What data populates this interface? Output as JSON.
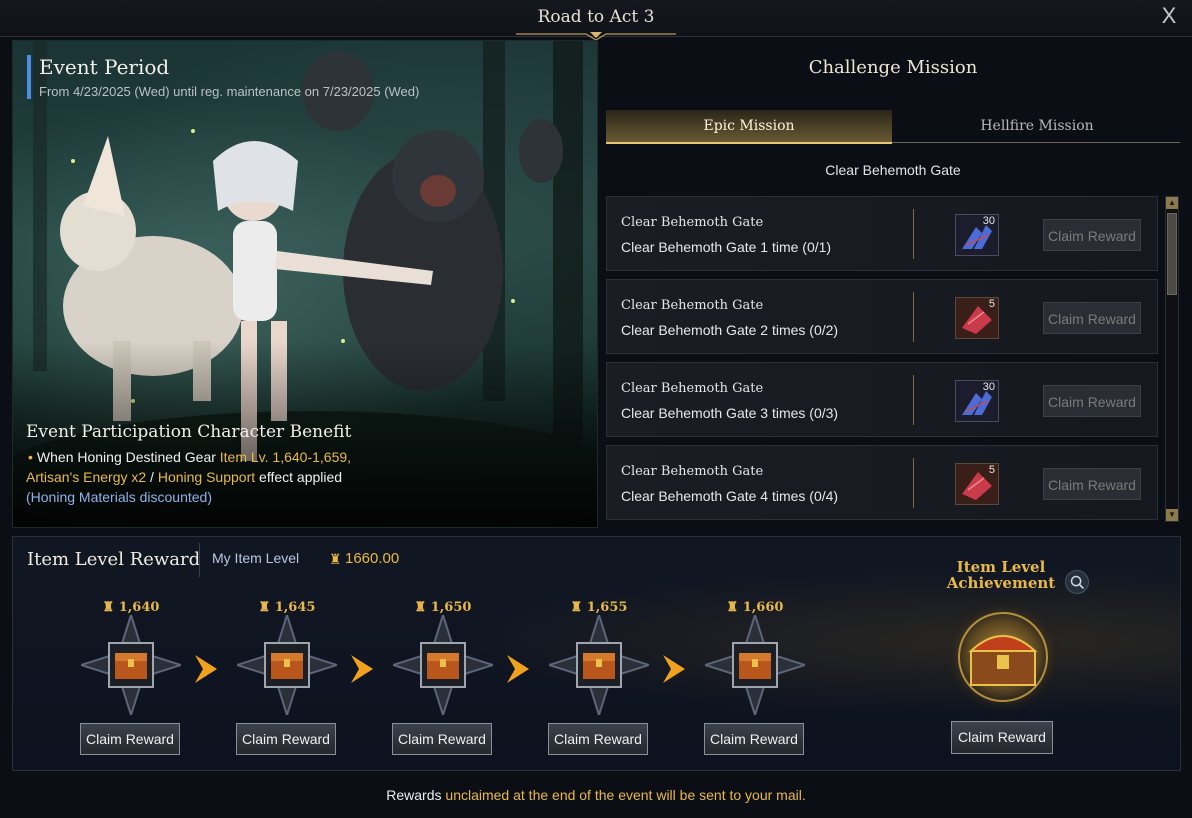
{
  "window": {
    "title": "Road to Act 3",
    "close_label": "X"
  },
  "banner": {
    "event_period_title": "Event Period",
    "event_period_dates": "From 4/23/2025 (Wed) until reg. maintenance on 7/23/2025 (Wed)",
    "benefit_title": "Event Participation Character Benefit",
    "benefit_line_prefix": "When Honing Destined Gear ",
    "benefit_item_level": "Item Lv. 1,640-1,659,",
    "benefit_energy": "Artisan's Energy x2",
    "benefit_slash": " / ",
    "benefit_support": "Honing Support",
    "benefit_suffix": " effect applied",
    "benefit_note": "(Honing Materials discounted)"
  },
  "challenge": {
    "title": "Challenge Mission",
    "tabs": [
      {
        "label": "Epic Mission",
        "active": true
      },
      {
        "label": "Hellfire Mission",
        "active": false
      }
    ],
    "heading": "Clear Behemoth Gate",
    "missions": [
      {
        "title": "Clear Behemoth Gate",
        "desc": "Clear Behemoth Gate 1 time (0/1)",
        "reward_count": "30",
        "reward_icon": "blue-crystal-icon",
        "claim_label": "Claim Reward"
      },
      {
        "title": "Clear Behemoth Gate",
        "desc": "Clear Behemoth Gate 2 times (0/2)",
        "reward_count": "5",
        "reward_icon": "red-crystal-icon",
        "claim_label": "Claim Reward"
      },
      {
        "title": "Clear Behemoth Gate",
        "desc": "Clear Behemoth Gate 3 times (0/3)",
        "reward_count": "30",
        "reward_icon": "blue-crystal-icon",
        "claim_label": "Claim Reward"
      },
      {
        "title": "Clear Behemoth Gate",
        "desc": "Clear Behemoth Gate 4 times (0/4)",
        "reward_count": "5",
        "reward_icon": "red-crystal-icon",
        "claim_label": "Claim Reward"
      }
    ]
  },
  "item_level_reward": {
    "title": "Item Level Reward",
    "my_item_level_label": "My Item Level",
    "my_item_level_value": "1660.00",
    "tiers": [
      {
        "level": "1,640",
        "claim_label": "Claim Reward"
      },
      {
        "level": "1,645",
        "claim_label": "Claim Reward"
      },
      {
        "level": "1,650",
        "claim_label": "Claim Reward"
      },
      {
        "level": "1,655",
        "claim_label": "Claim Reward"
      },
      {
        "level": "1,660",
        "claim_label": "Claim Reward"
      }
    ],
    "achievement_title": "Item Level Achievement",
    "achievement_claim_label": "Claim Reward"
  },
  "footer": {
    "prefix": "Rewards ",
    "highlight": "unclaimed at the end of the event will be sent to your mail."
  },
  "colors": {
    "accent_gold": "#e8b94a",
    "accent_blue": "#4d8de0",
    "panel_bg": "#111722"
  }
}
